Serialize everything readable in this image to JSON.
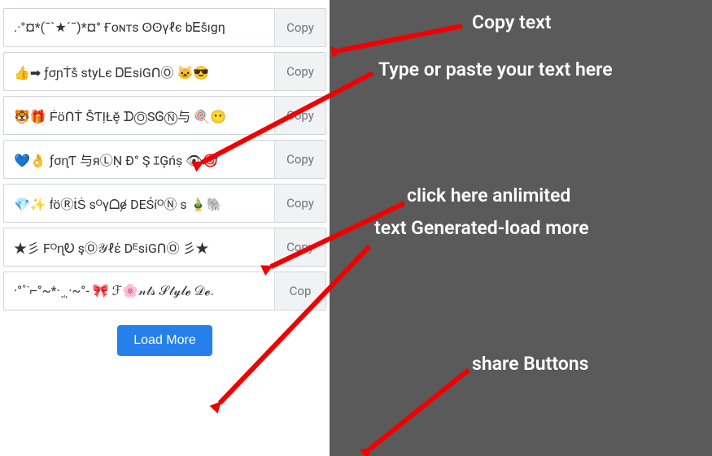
{
  "rows": [
    {
      "text": ".·°¤*(¯`★´¯)*¤° Ғᴏɴтѕ ʘʘүℓє bᎬṧıgη",
      "copy": "Copy"
    },
    {
      "text": "👍➡ ƒσɲṪṧ styLє ᎠᎬsiGᑎⓄ 🐱😎",
      "copy": "Copy"
    },
    {
      "text": "🐯🎁 ḞöᑎṪ ṦƬỊŁḝ ᗪⓄSᎶⓃ与 🍭😶",
      "copy": "Copy"
    },
    {
      "text": "💙👌 ƒσɳƬ 与яⓁṆ Ð° Ş ｴĢńṣ  👁🎯",
      "copy": "Copy"
    },
    {
      "text": "💎✨ ḟöⓇṫṠ sᴼүᗝɇ DEŚíᴼⓃ s 🎍🐘",
      "copy": "Copy"
    },
    {
      "text": "★彡 FᴼɳᎧ şⓄ𝒴ℓέ DᴱsiGᑎⓄ 彡★",
      "copy": "Copy"
    },
    {
      "text": "·°˚˙⌐°~*·ͺ͔ͺ·~°- 🎀 ℱ🌸𝓃𝓉𝓈 𝒮𝓉𝓎𝓁𝓮 𝒟𝓮.",
      "copy": "Cop"
    }
  ],
  "load_more_label": "Load More",
  "annotations": {
    "copy_text": "Copy text",
    "type_paste": "Type or paste your text here",
    "click_unlimited_line1": "click here anlimited",
    "click_unlimited_line2": "text Generated-load more",
    "share_buttons": "share Buttons"
  }
}
